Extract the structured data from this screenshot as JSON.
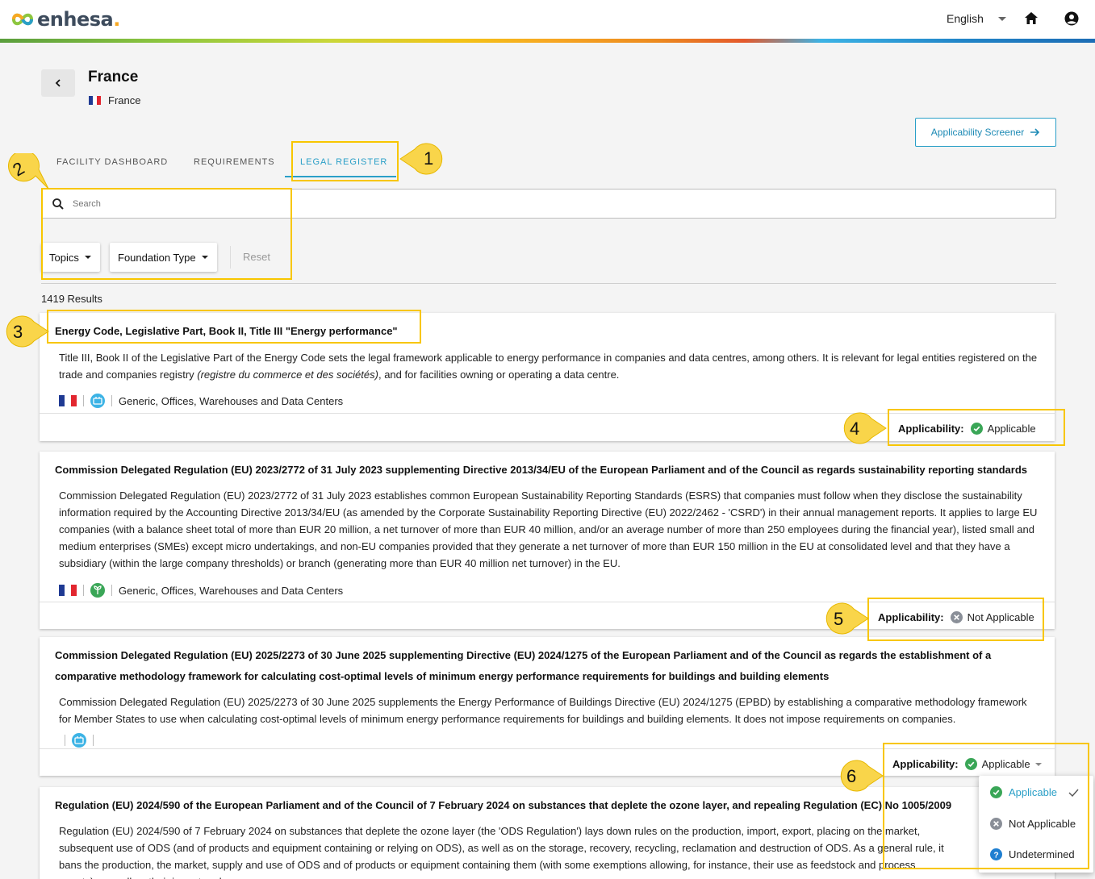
{
  "header": {
    "logo_text": "enhesa",
    "logo_dot": ".",
    "language": "English"
  },
  "page": {
    "title": "France",
    "subtitle": "France",
    "screener_label": "Applicability Screener"
  },
  "tabs": [
    {
      "label": "FACILITY DASHBOARD"
    },
    {
      "label": "REQUIREMENTS"
    },
    {
      "label": "LEGAL REGISTER"
    }
  ],
  "search": {
    "placeholder": "Search"
  },
  "filters": {
    "topics": "Topics",
    "foundation": "Foundation Type",
    "reset": "Reset"
  },
  "results_count": "1419 Results",
  "cards": [
    {
      "title": "Energy Code, Legislative Part, Book II, Title III \"Energy performance\"",
      "desc_a": "Title III, Book II of the Legislative Part of the Energy Code sets the legal framework applicable to energy performance in companies and data centres, among others. It is relevant for legal entities registered on the trade and companies registry ",
      "desc_em": "(registre du commerce et des sociétés)",
      "desc_b": ", and for facilities owning or operating a data centre.",
      "tags": "Generic, Offices, Warehouses and Data Centers",
      "applic_label": "Applicability:",
      "applic_value": "Applicable"
    },
    {
      "title": "Commission Delegated Regulation (EU) 2023/2772 of 31 July 2023 supplementing Directive 2013/34/EU of the European Parliament and of the Council as regards sustainability reporting standards",
      "desc": "Commission Delegated Regulation (EU) 2023/2772 of 31 July 2023 establishes common European Sustainability Reporting Standards (ESRS) that companies must follow when they disclose the sustainability information required by the Accounting Directive 2013/34/EU (as amended by the Corporate Sustainability Reporting Directive (EU) 2022/2462 - 'CSRD') in their annual management reports. It applies to large EU companies (with a balance sheet total of more than EUR 20 million, a net turnover of more than EUR 40 million, and/or an average number of more than 250 employees during the financial year), listed small and medium enterprises (SMEs) except micro undertakings, and non-EU companies provided that they generate a net turnover of more than EUR 150 million in the EU at consolidated level and that they have a subsidiary (within the large company thresholds) or branch (generating more than EUR 40 million net turnover) in the EU.",
      "tags": "Generic, Offices, Warehouses and Data Centers",
      "applic_label": "Applicability:",
      "applic_value": "Not Applicable"
    },
    {
      "title": "Commission Delegated Regulation (EU) 2025/2273 of 30 June 2025 supplementing Directive (EU) 2024/1275 of the European Parliament and of the Council as regards the establishment of a comparative methodology framework for calculating cost-optimal levels of minimum energy performance requirements for buildings and building elements",
      "desc": "Commission Delegated Regulation (EU) 2025/2273 of 30 June 2025 supplements the Energy Performance of Buildings Directive (EU) 2024/1275 (EPBD) by establishing a comparative methodology framework for Member States to use when calculating cost-optimal levels of minimum energy performance requirements for buildings and building elements. It does not impose requirements on companies.",
      "applic_label": "Applicability:",
      "applic_value": "Applicable"
    },
    {
      "title": "Regulation (EU) 2024/590 of the European Parliament and of the Council of 7 February 2024 on substances that deplete the ozone layer, and repealing Regulation (EC) No 1005/2009",
      "desc": "Regulation (EU) 2024/590 of 7 February 2024 on substances that deplete the ozone layer (the 'ODS Regulation') lays down rules on the production, import, export, placing on the market, subsequent use of ODS (and of products and equipment containing or relying on ODS), as well as on the storage, recovery, recycling, reclamation and destruction of ODS. As a general rule, it bans the production, the market, supply and use of ODS and of products or equipment containing them (with some exemptions allowing, for instance, their use as feedstock and process agents), as well as their import and"
    }
  ],
  "dropdown": [
    {
      "label": "Applicable"
    },
    {
      "label": "Not Applicable"
    },
    {
      "label": "Undetermined"
    }
  ],
  "annotations": [
    "1",
    "2",
    "3",
    "4",
    "5",
    "6"
  ],
  "colors": {
    "accent": "#2a9fc7",
    "highlight": "#f8c600",
    "callout": "#f9d54a",
    "applicable": "#3aa657",
    "not_applicable": "#8a8f98",
    "undetermined": "#1f7fd1"
  }
}
